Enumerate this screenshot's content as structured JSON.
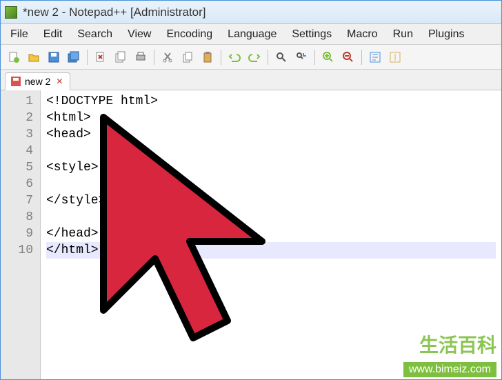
{
  "window": {
    "title": "*new 2 - Notepad++ [Administrator]"
  },
  "menubar": {
    "items": [
      "File",
      "Edit",
      "Search",
      "View",
      "Encoding",
      "Language",
      "Settings",
      "Macro",
      "Run",
      "Plugins"
    ]
  },
  "toolbar": {
    "icons": [
      "new-file-icon",
      "open-file-icon",
      "save-icon",
      "save-all-icon",
      "close-icon",
      "close-all-icon",
      "print-icon",
      "cut-icon",
      "copy-icon",
      "paste-icon",
      "undo-icon",
      "redo-icon",
      "find-icon",
      "replace-icon",
      "zoom-in-icon",
      "zoom-out-icon",
      "sync-v-icon",
      "sync-h-icon"
    ]
  },
  "tabs": {
    "items": [
      {
        "label": "new 2",
        "modified": true
      }
    ]
  },
  "editor": {
    "lines": [
      "<!DOCTYPE html>",
      "<html>",
      "<head>",
      "",
      "<style>",
      "",
      "</style>",
      "",
      "</head>",
      "</html>"
    ],
    "currentLine": 10
  },
  "watermark": {
    "cn": "生活百科",
    "url": "www.bimeiz.com"
  }
}
